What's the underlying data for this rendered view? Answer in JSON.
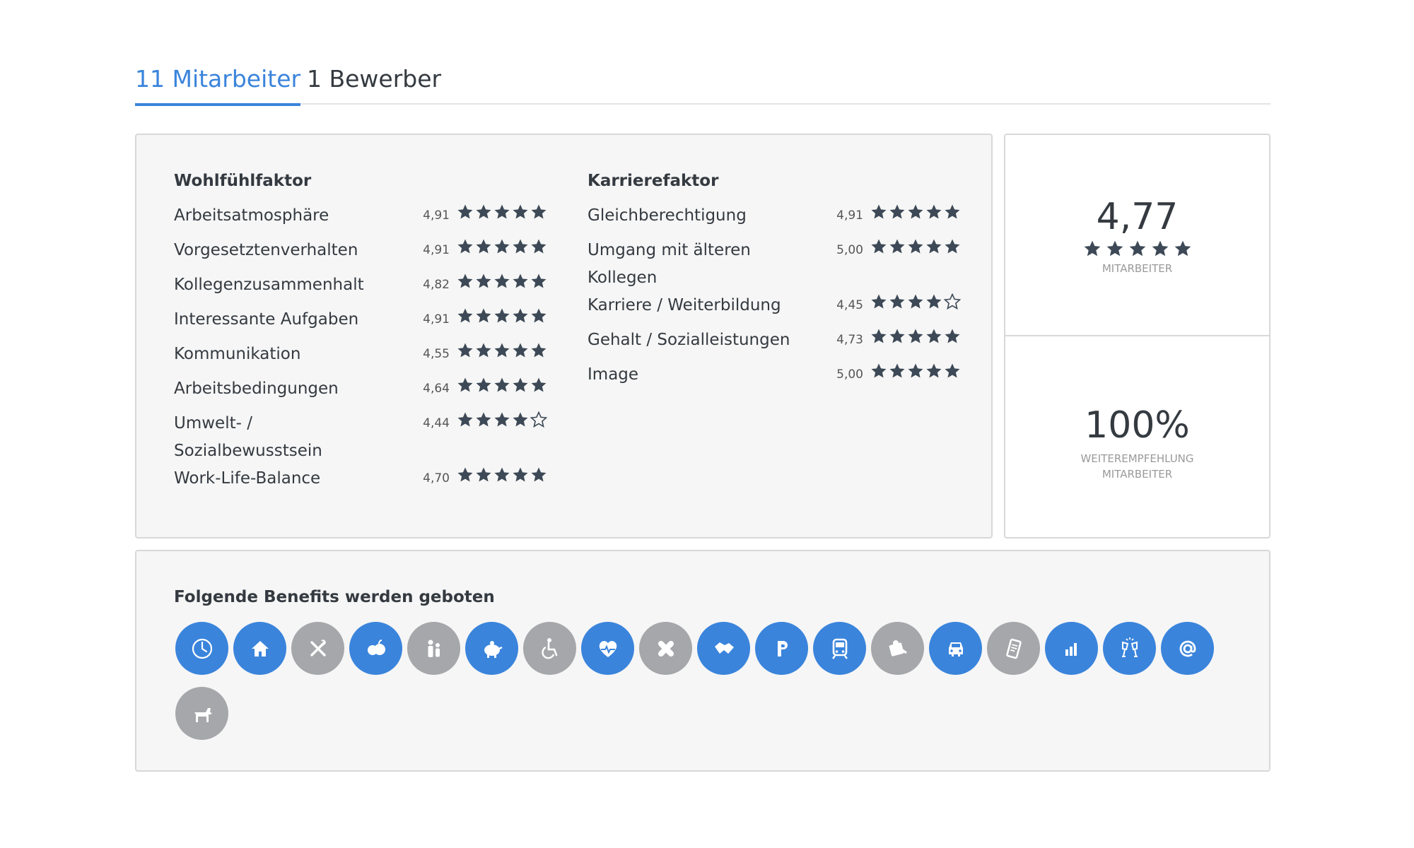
{
  "tabs": [
    {
      "label": "11 Mitarbeiter",
      "active": true
    },
    {
      "label": "1 Bewerber",
      "active": false
    }
  ],
  "wohlfuehl": {
    "title": "Wohlfühlfaktor",
    "items": [
      {
        "label": "Arbeitsatmosphäre",
        "value": "4,91",
        "rating": 4.91
      },
      {
        "label": "Vorgesetztenverhalten",
        "value": "4,91",
        "rating": 4.91
      },
      {
        "label": "Kollegenzusammenhalt",
        "value": "4,82",
        "rating": 4.82
      },
      {
        "label": "Interessante Aufgaben",
        "value": "4,91",
        "rating": 4.91
      },
      {
        "label": "Kommunikation",
        "value": "4,55",
        "rating": 4.55
      },
      {
        "label": "Arbeitsbedingungen",
        "value": "4,64",
        "rating": 4.64
      },
      {
        "label": "Umwelt- / Sozialbewusstsein",
        "value": "4,44",
        "rating": 4.44
      },
      {
        "label": "Work-Life-Balance",
        "value": "4,70",
        "rating": 4.7
      }
    ]
  },
  "karriere": {
    "title": "Karrierefaktor",
    "items": [
      {
        "label": "Gleichberechtigung",
        "value": "4,91",
        "rating": 4.91
      },
      {
        "label": "Umgang mit älteren Kollegen",
        "value": "5,00",
        "rating": 5.0
      },
      {
        "label": "Karriere / Weiterbildung",
        "value": "4,45",
        "rating": 4.45
      },
      {
        "label": "Gehalt / Sozialleistungen",
        "value": "4,73",
        "rating": 4.73
      },
      {
        "label": "Image",
        "value": "5,00",
        "rating": 5.0
      }
    ]
  },
  "score": {
    "value": "4,77",
    "rating": 4.77,
    "label": "MITARBEITER"
  },
  "recommendation": {
    "value": "100%",
    "label_line1": "WEITEREMPFEHLUNG",
    "label_line2": "MITARBEITER"
  },
  "benefits": {
    "title": "Folgende Benefits werden geboten",
    "items": [
      {
        "icon": "clock-icon",
        "active": true
      },
      {
        "icon": "home-icon",
        "active": true
      },
      {
        "icon": "cutlery-icon",
        "active": false
      },
      {
        "icon": "fruit-icon",
        "active": true
      },
      {
        "icon": "family-icon",
        "active": false
      },
      {
        "icon": "piggy-bank-icon",
        "active": true
      },
      {
        "icon": "wheelchair-icon",
        "active": false
      },
      {
        "icon": "heart-pulse-icon",
        "active": true
      },
      {
        "icon": "bandage-icon",
        "active": false
      },
      {
        "icon": "handshake-icon",
        "active": true
      },
      {
        "icon": "parking-icon",
        "active": true
      },
      {
        "icon": "train-icon",
        "active": true
      },
      {
        "icon": "discount-icon",
        "active": false
      },
      {
        "icon": "car-icon",
        "active": true
      },
      {
        "icon": "phone-icon",
        "active": false
      },
      {
        "icon": "chart-icon",
        "active": true
      },
      {
        "icon": "celebration-icon",
        "active": true
      },
      {
        "icon": "at-icon",
        "active": true
      },
      {
        "icon": "dog-icon",
        "active": false
      }
    ]
  },
  "colors": {
    "accent": "#3a84dc",
    "inactive": "#a5a7aa",
    "star": "#3d4956"
  }
}
